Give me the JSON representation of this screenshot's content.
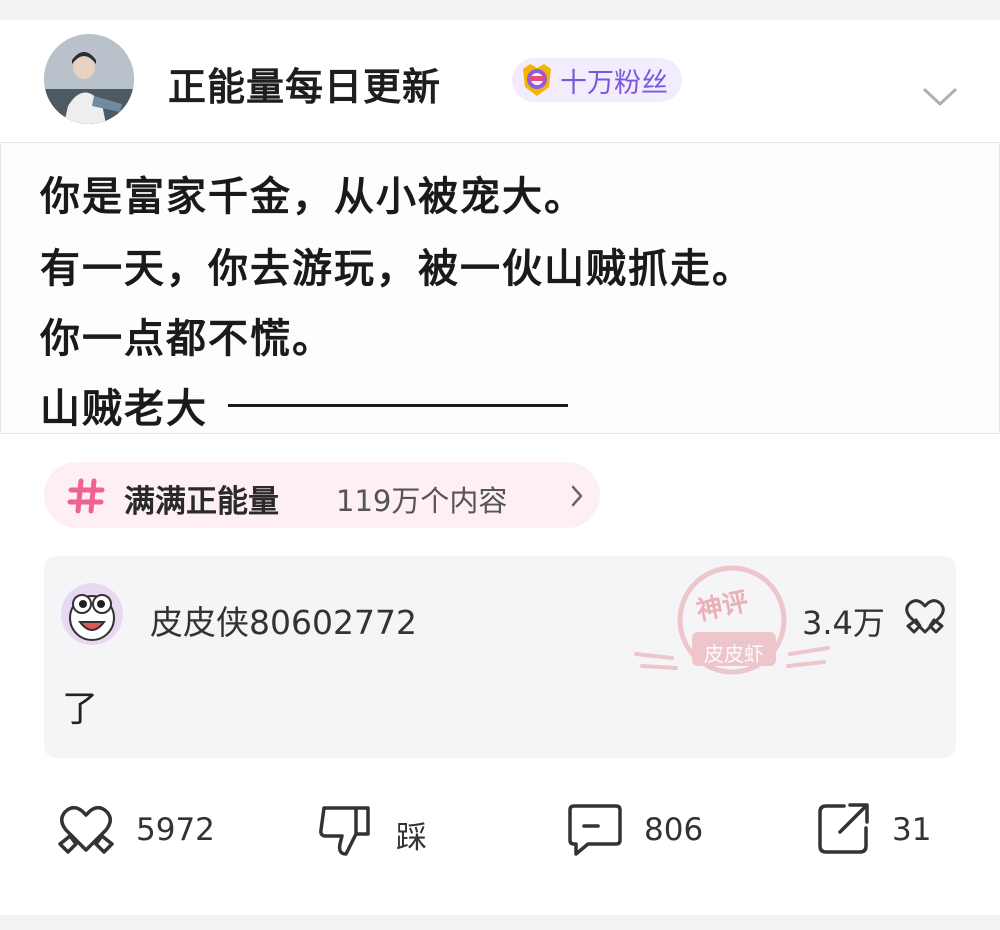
{
  "author": {
    "name": "正能量每日更新",
    "badge": "十万粉丝",
    "badge_color": "#7b58d6"
  },
  "post": {
    "lines": [
      "你是富家千金，从小被宠大。",
      "有一天，你去游玩，被一伙山贼抓走。",
      "你一点都不慌。",
      "山贼老大"
    ]
  },
  "topic": {
    "name": "满满正能量",
    "count": "119万个内容",
    "accent": "#f06292"
  },
  "comment": {
    "user": "皮皮侠80602772",
    "likes": "3.4万",
    "text": "了",
    "stamp_top": "神评",
    "stamp_bottom": "皮皮虾",
    "stamp_color": "#e8a0aa"
  },
  "actions": {
    "like_count": "5972",
    "dislike_label": "踩",
    "comment_count": "806",
    "share_count": "31"
  },
  "icons": [
    "avatar",
    "medal-icon",
    "chevron-down-icon",
    "hash-icon",
    "chevron-right-icon",
    "heart-icon",
    "thumbs-down-icon",
    "comment-icon",
    "share-icon"
  ]
}
